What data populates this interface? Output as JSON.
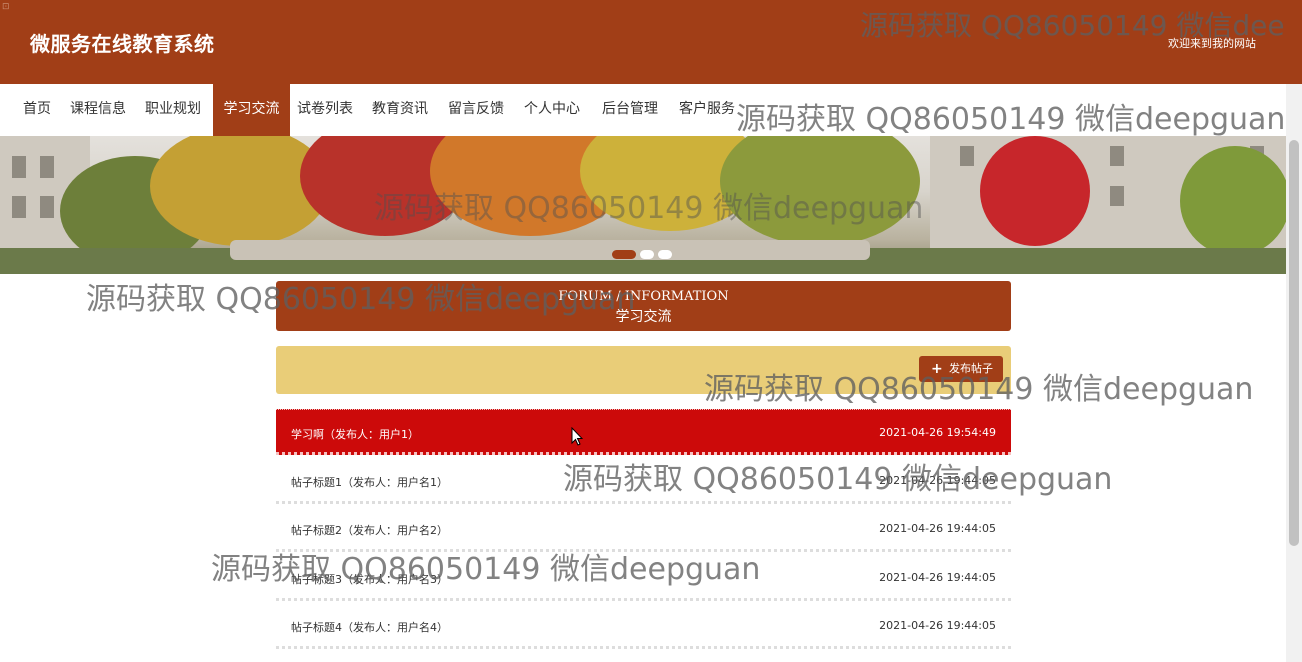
{
  "site": {
    "title": "微服务在线教育系统",
    "welcome": "欢迎来到我的网站",
    "corner_glyph": "⊡"
  },
  "nav": {
    "items": [
      {
        "label": "首页"
      },
      {
        "label": "课程信息"
      },
      {
        "label": "职业规划"
      },
      {
        "label": "学习交流",
        "active": true
      },
      {
        "label": "试卷列表"
      },
      {
        "label": "教育资讯"
      },
      {
        "label": "留言反馈"
      },
      {
        "label": "个人中心"
      },
      {
        "label": "后台管理"
      },
      {
        "label": "客户服务"
      }
    ]
  },
  "banner": {
    "slide_count": 3,
    "active_slide": 1
  },
  "section": {
    "title_en": "FORUM / INFORMATION",
    "title_cn": "学习交流"
  },
  "toolbar": {
    "post_button_label": "发布帖子",
    "post_button_icon": "plus-icon"
  },
  "posts": [
    {
      "title": "学习啊（发布人：用户1）",
      "time": "2021-04-26 19:54:49",
      "highlighted": true
    },
    {
      "title": "帖子标题1（发布人：用户名1）",
      "time": "2021-04-26 19:44:05"
    },
    {
      "title": "帖子标题2（发布人：用户名2）",
      "time": "2021-04-26 19:44:05"
    },
    {
      "title": "帖子标题3（发布人：用户名3）",
      "time": "2021-04-26 19:44:05"
    },
    {
      "title": "帖子标题4（发布人：用户名4）",
      "time": "2021-04-26 19:44:05"
    }
  ],
  "watermarks": [
    "源码获取 QQ86050149 微信dee",
    "源码获取 QQ86050149 微信deepguan",
    "源码获取 QQ86050149 微信deepguan",
    "源码获取 QQ86050149 微信deepguan",
    "源码获取 QQ86050149 微信deepguan",
    "源码获取 QQ86050149 微信deepguan",
    "源码获取 QQ86050149 微信deepguan"
  ],
  "colors": {
    "brand": "#a13e17",
    "highlight_row": "#cc0a0a",
    "toolbar_bg": "#e9cd78"
  }
}
